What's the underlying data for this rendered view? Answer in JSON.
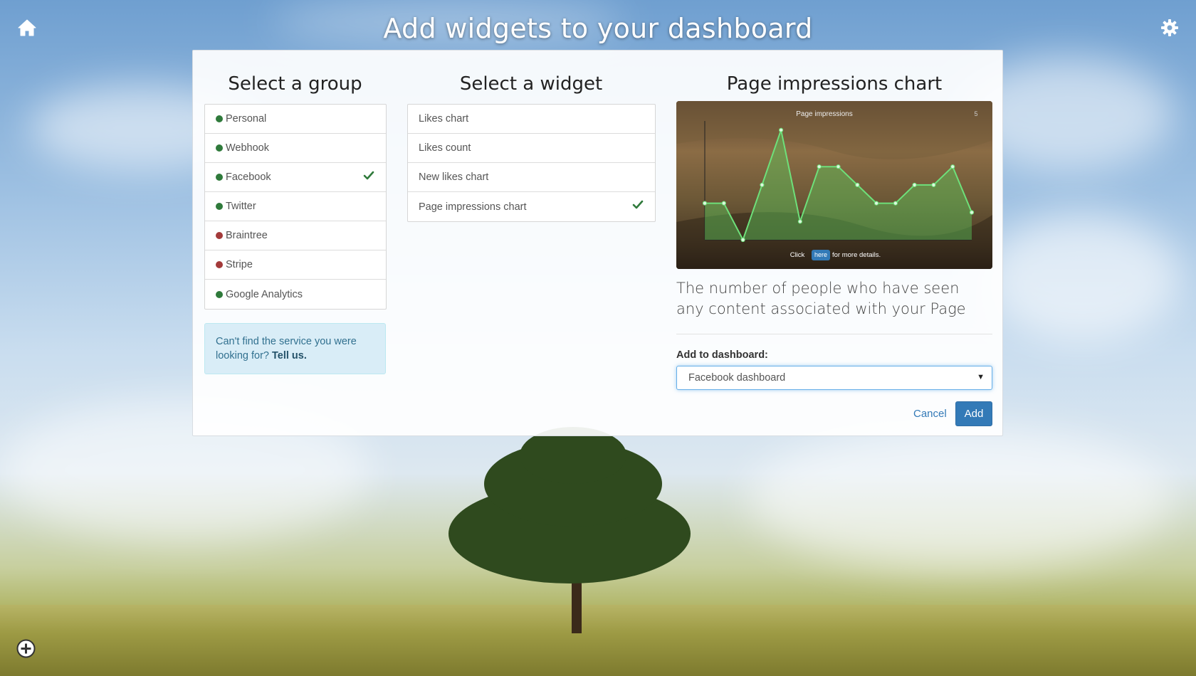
{
  "header": {
    "title": "Add widgets to your dashboard"
  },
  "groups": {
    "title": "Select a group",
    "items": [
      {
        "label": "Personal",
        "status_color": "#2f7a3b",
        "selected": false
      },
      {
        "label": "Webhook",
        "status_color": "#2f7a3b",
        "selected": false
      },
      {
        "label": "Facebook",
        "status_color": "#2f7a3b",
        "selected": true
      },
      {
        "label": "Twitter",
        "status_color": "#2f7a3b",
        "selected": false
      },
      {
        "label": "Braintree",
        "status_color": "#a33a3a",
        "selected": false
      },
      {
        "label": "Stripe",
        "status_color": "#a33a3a",
        "selected": false
      },
      {
        "label": "Google Analytics",
        "status_color": "#2f7a3b",
        "selected": false
      }
    ],
    "help_text": "Can't find the service you were looking for?",
    "help_link": "Tell us."
  },
  "widgets": {
    "title": "Select a widget",
    "items": [
      {
        "label": "Likes chart",
        "selected": false
      },
      {
        "label": "Likes count",
        "selected": false
      },
      {
        "label": "New likes chart",
        "selected": false
      },
      {
        "label": "Page impressions chart",
        "selected": true
      }
    ]
  },
  "detail": {
    "title": "Page impressions chart",
    "description": "The number of people who have seen any content associated with your Page",
    "add_to_label": "Add to dashboard:",
    "dashboard_value": "Facebook dashboard",
    "cancel_label": "Cancel",
    "add_label": "Add"
  },
  "chart_data": {
    "type": "area",
    "title": "Page impressions",
    "corner_label": "5",
    "footer_prefix": "Click",
    "footer_link": "here",
    "footer_suffix": "for more details.",
    "values": [
      2,
      2,
      0,
      3,
      6,
      1,
      4,
      4,
      3,
      2,
      2,
      3,
      3,
      4,
      1.5
    ],
    "ylim": [
      0,
      6.5
    ],
    "line_color": "#6ee07a",
    "fill_color": "rgba(90,200,90,0.45)"
  },
  "icons": {
    "home": "home-icon",
    "settings": "gear-icon",
    "add": "plus-circle-icon",
    "check": "check-icon"
  },
  "colors": {
    "accent": "#337ab7",
    "check": "#2f7a3b"
  }
}
